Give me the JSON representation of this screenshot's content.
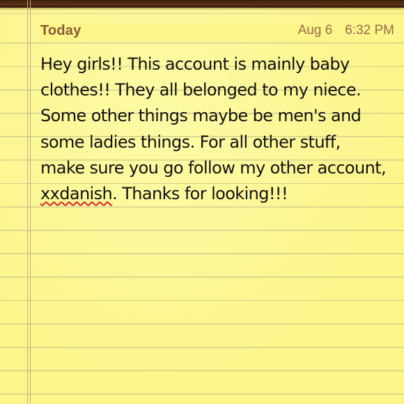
{
  "note": {
    "header_label": "Today",
    "date": "Aug 6",
    "time": "6:32 PM",
    "body_part1": "Hey girls!! This account is mainly baby clothes!! They all belonged to my niece. Some other things maybe be men's and some ladies things. For all other stuff, make sure you go follow my other account, ",
    "misspelled_word": "xxdanish",
    "body_part2": ". Thanks for looking!!!"
  },
  "colors": {
    "paper": "#fbf58a",
    "rule_line": "#d2cf8e",
    "margin_line": "#c9a98a",
    "header_text": "#8a5a3a",
    "binding": "#3a1e0c",
    "spellcheck_underline": "#dd2222"
  }
}
